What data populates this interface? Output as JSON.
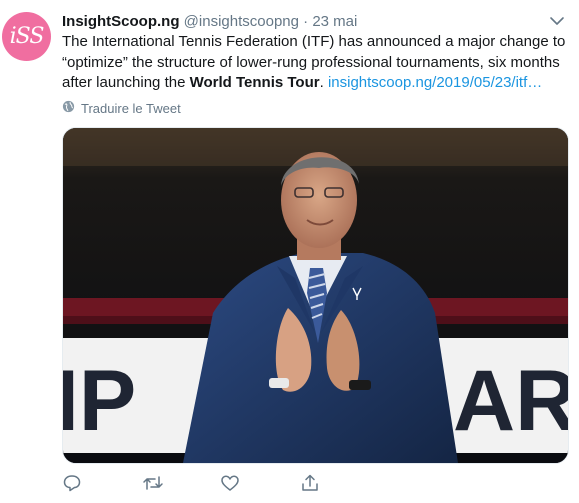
{
  "author": {
    "avatar_text": "iSS",
    "avatar_color": "#f06ea0",
    "name": "InsightScoop.ng",
    "handle": "@insightscoopng",
    "separator": "·",
    "date": "23 mai"
  },
  "tweet": {
    "text_part1": "The International Tennis Federation (ITF) has announced a major change to “optimize” the structure of lower-rung professional tournaments, six months after launching the ",
    "text_bold": "World Tennis Tour",
    "text_part2": ". ",
    "link_text": "insightscoop.ng/2019/05/23/itf…"
  },
  "translate": {
    "label": "Traduire le Tweet"
  },
  "media": {
    "banner_text_left": "IP",
    "banner_text_right": "ARI",
    "colors": {
      "link": "#1b95e0",
      "muted": "#657786",
      "jacket": "#223b6b"
    }
  },
  "actions": [
    "reply-icon",
    "retweet-icon",
    "like-icon",
    "share-icon"
  ]
}
